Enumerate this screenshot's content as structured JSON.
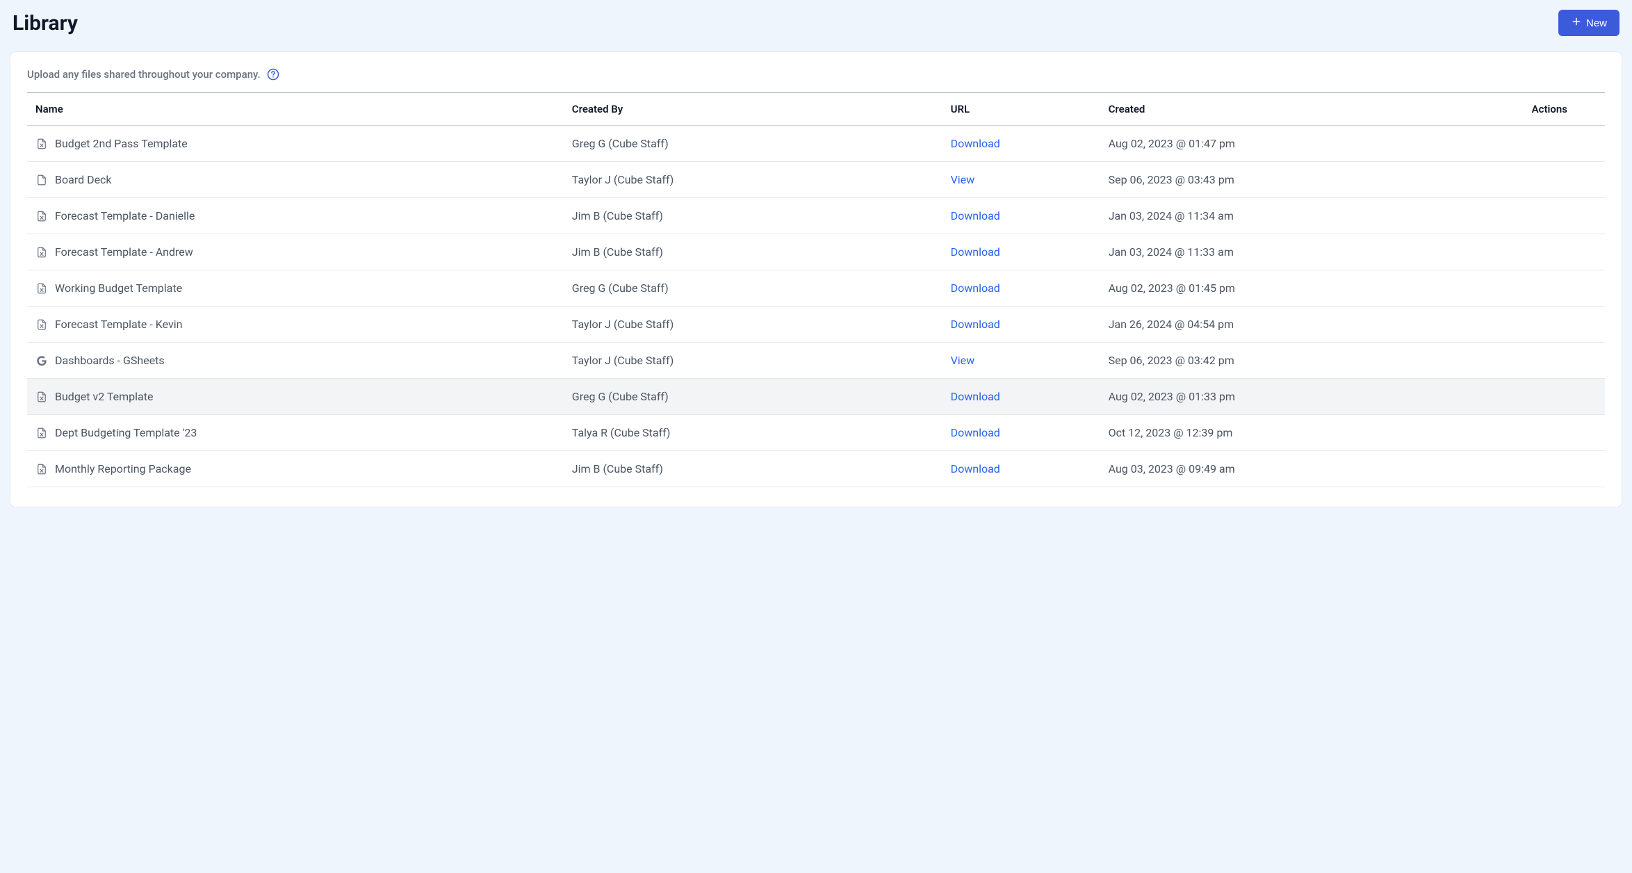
{
  "page": {
    "title": "Library",
    "newButton": "New",
    "description": "Upload any files shared throughout your company."
  },
  "table": {
    "headers": {
      "name": "Name",
      "createdBy": "Created By",
      "url": "URL",
      "created": "Created",
      "actions": "Actions"
    },
    "rows": [
      {
        "icon": "excel",
        "name": "Budget 2nd Pass Template",
        "createdBy": "Greg G (Cube Staff)",
        "urlLabel": "Download",
        "created": "Aug 02, 2023 @ 01:47 pm",
        "hovered": false
      },
      {
        "icon": "doc",
        "name": "Board Deck",
        "createdBy": "Taylor J (Cube Staff)",
        "urlLabel": "View",
        "created": "Sep 06, 2023 @ 03:43 pm",
        "hovered": false
      },
      {
        "icon": "excel",
        "name": "Forecast Template - Danielle",
        "createdBy": "Jim B (Cube Staff)",
        "urlLabel": "Download",
        "created": "Jan 03, 2024 @ 11:34 am",
        "hovered": false
      },
      {
        "icon": "excel",
        "name": "Forecast Template - Andrew",
        "createdBy": "Jim B (Cube Staff)",
        "urlLabel": "Download",
        "created": "Jan 03, 2024 @ 11:33 am",
        "hovered": false
      },
      {
        "icon": "excel",
        "name": "Working Budget Template",
        "createdBy": "Greg G (Cube Staff)",
        "urlLabel": "Download",
        "created": "Aug 02, 2023 @ 01:45 pm",
        "hovered": false
      },
      {
        "icon": "excel",
        "name": "Forecast Template - Kevin",
        "createdBy": "Taylor J (Cube Staff)",
        "urlLabel": "Download",
        "created": "Jan 26, 2024 @ 04:54 pm",
        "hovered": false
      },
      {
        "icon": "google",
        "name": "Dashboards - GSheets",
        "createdBy": "Taylor J (Cube Staff)",
        "urlLabel": "View",
        "created": "Sep 06, 2023 @ 03:42 pm",
        "hovered": false
      },
      {
        "icon": "excel",
        "name": "Budget v2 Template",
        "createdBy": "Greg G (Cube Staff)",
        "urlLabel": "Download",
        "created": "Aug 02, 2023 @ 01:33 pm",
        "hovered": true
      },
      {
        "icon": "excel",
        "name": "Dept Budgeting Template '23",
        "createdBy": "Talya R (Cube Staff)",
        "urlLabel": "Download",
        "created": "Oct 12, 2023 @ 12:39 pm",
        "hovered": false
      },
      {
        "icon": "excel",
        "name": "Monthly Reporting Package",
        "createdBy": "Jim B (Cube Staff)",
        "urlLabel": "Download",
        "created": "Aug 03, 2023 @ 09:49 am",
        "hovered": false
      }
    ]
  }
}
